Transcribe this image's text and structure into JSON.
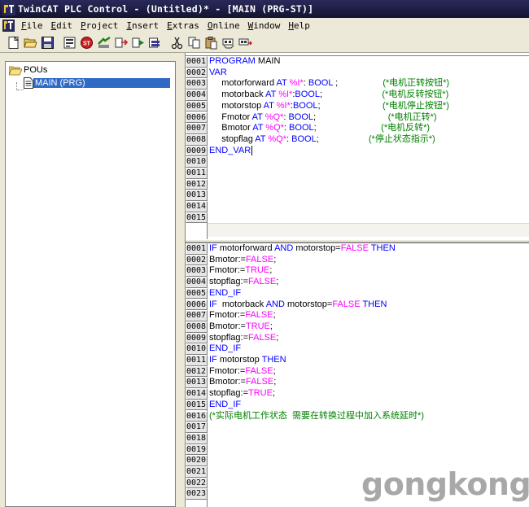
{
  "window": {
    "title": "TwinCAT PLC Control - (Untitled)* - [MAIN (PRG-ST)]"
  },
  "menu": {
    "items": [
      {
        "underline": "F",
        "rest": "ile"
      },
      {
        "underline": "E",
        "rest": "dit"
      },
      {
        "underline": "P",
        "rest": "roject"
      },
      {
        "underline": "I",
        "rest": "nsert"
      },
      {
        "underline": "E",
        "rest": "xtras"
      },
      {
        "underline": "O",
        "rest": "nline"
      },
      {
        "underline": "W",
        "rest": "indow"
      },
      {
        "underline": "H",
        "rest": "elp"
      }
    ]
  },
  "toolbar": {
    "buttons": [
      "new-icon",
      "open-icon",
      "save-icon",
      "sep",
      "build-icon",
      "stop-icon",
      "login-icon",
      "logout-icon",
      "run-icon",
      "step-icon",
      "sep",
      "cut-icon",
      "copy-icon",
      "paste-icon",
      "find-icon",
      "find-next-icon"
    ]
  },
  "tree": {
    "root_label": "POUs",
    "child_label": "MAIN (PRG)"
  },
  "declaration": {
    "lines": [
      {
        "num": "0001",
        "tokens": [
          {
            "t": "kw",
            "v": "PROGRAM"
          },
          {
            "t": "plain",
            "v": " MAIN"
          }
        ]
      },
      {
        "num": "0002",
        "tokens": [
          {
            "t": "kw",
            "v": "VAR"
          }
        ]
      },
      {
        "num": "0003",
        "tokens": [
          {
            "t": "plain",
            "v": "     motorforward "
          },
          {
            "t": "kw",
            "v": "AT"
          },
          {
            "t": "plain",
            "v": " "
          },
          {
            "t": "lit",
            "v": "%I*"
          },
          {
            "t": "plain",
            "v": ": "
          },
          {
            "t": "kw",
            "v": "BOOL"
          },
          {
            "t": "plain",
            "v": " ;                  "
          },
          {
            "t": "cmt",
            "v": "(*电机正转按钮*)"
          }
        ]
      },
      {
        "num": "0004",
        "tokens": [
          {
            "t": "plain",
            "v": "     motorback "
          },
          {
            "t": "kw",
            "v": "AT"
          },
          {
            "t": "plain",
            "v": " "
          },
          {
            "t": "lit",
            "v": "%I*"
          },
          {
            "t": "plain",
            "v": ":"
          },
          {
            "t": "kw",
            "v": "BOOL"
          },
          {
            "t": "plain",
            "v": ";                        "
          },
          {
            "t": "cmt",
            "v": "(*电机反转按钮*)"
          }
        ]
      },
      {
        "num": "0005",
        "tokens": [
          {
            "t": "plain",
            "v": "     motorstop "
          },
          {
            "t": "kw",
            "v": "AT"
          },
          {
            "t": "plain",
            "v": " "
          },
          {
            "t": "lit",
            "v": "%I*"
          },
          {
            "t": "plain",
            "v": ":"
          },
          {
            "t": "kw",
            "v": "BOOL"
          },
          {
            "t": "plain",
            "v": ";                         "
          },
          {
            "t": "cmt",
            "v": "(*电机停止按钮*)"
          }
        ]
      },
      {
        "num": "0006",
        "tokens": [
          {
            "t": "plain",
            "v": "     Fmotor "
          },
          {
            "t": "kw",
            "v": "AT"
          },
          {
            "t": "plain",
            "v": " "
          },
          {
            "t": "lit",
            "v": "%Q*"
          },
          {
            "t": "plain",
            "v": ": "
          },
          {
            "t": "kw",
            "v": "BOOL"
          },
          {
            "t": "plain",
            "v": ";                             "
          },
          {
            "t": "cmt",
            "v": "(*电机正转*)"
          }
        ]
      },
      {
        "num": "0007",
        "tokens": [
          {
            "t": "plain",
            "v": "     Bmotor "
          },
          {
            "t": "kw",
            "v": "AT"
          },
          {
            "t": "plain",
            "v": " "
          },
          {
            "t": "lit",
            "v": "%Q*"
          },
          {
            "t": "plain",
            "v": ": "
          },
          {
            "t": "kw",
            "v": "BOOL"
          },
          {
            "t": "plain",
            "v": ";                          "
          },
          {
            "t": "cmt",
            "v": "(*电机反转*)"
          }
        ]
      },
      {
        "num": "0008",
        "tokens": [
          {
            "t": "plain",
            "v": "     stopflag "
          },
          {
            "t": "kw",
            "v": "AT"
          },
          {
            "t": "plain",
            "v": " "
          },
          {
            "t": "lit",
            "v": "%Q*"
          },
          {
            "t": "plain",
            "v": ": "
          },
          {
            "t": "kw",
            "v": "BOOL"
          },
          {
            "t": "plain",
            "v": ";                    "
          },
          {
            "t": "cmt",
            "v": "(*停止状态指示*)"
          }
        ]
      },
      {
        "num": "0009",
        "tokens": [
          {
            "t": "kw",
            "v": "END_VAR"
          }
        ],
        "caret": true
      },
      {
        "num": "0010",
        "tokens": []
      },
      {
        "num": "0011",
        "tokens": []
      },
      {
        "num": "0012",
        "tokens": []
      },
      {
        "num": "0013",
        "tokens": []
      },
      {
        "num": "0014",
        "tokens": []
      },
      {
        "num": "0015",
        "tokens": []
      }
    ]
  },
  "body": {
    "lines": [
      {
        "num": "0001",
        "tokens": [
          {
            "t": "kw",
            "v": "IF"
          },
          {
            "t": "plain",
            "v": " motorforward "
          },
          {
            "t": "kw",
            "v": "AND"
          },
          {
            "t": "plain",
            "v": " motorstop="
          },
          {
            "t": "lit",
            "v": "FALSE"
          },
          {
            "t": "plain",
            "v": " "
          },
          {
            "t": "kw",
            "v": "THEN"
          }
        ]
      },
      {
        "num": "0002",
        "tokens": [
          {
            "t": "plain",
            "v": "Bmotor:="
          },
          {
            "t": "lit",
            "v": "FALSE"
          },
          {
            "t": "plain",
            "v": ";"
          }
        ]
      },
      {
        "num": "0003",
        "tokens": [
          {
            "t": "plain",
            "v": "Fmotor:="
          },
          {
            "t": "lit",
            "v": "TRUE"
          },
          {
            "t": "plain",
            "v": ";"
          }
        ]
      },
      {
        "num": "0004",
        "tokens": [
          {
            "t": "plain",
            "v": "stopflag:="
          },
          {
            "t": "lit",
            "v": "FALSE"
          },
          {
            "t": "plain",
            "v": ";"
          }
        ]
      },
      {
        "num": "0005",
        "tokens": [
          {
            "t": "kw",
            "v": "END_IF"
          }
        ]
      },
      {
        "num": "0006",
        "tokens": [
          {
            "t": "kw",
            "v": "IF"
          },
          {
            "t": "plain",
            "v": "  motorback "
          },
          {
            "t": "kw",
            "v": "AND"
          },
          {
            "t": "plain",
            "v": " motorstop="
          },
          {
            "t": "lit",
            "v": "FALSE"
          },
          {
            "t": "plain",
            "v": " "
          },
          {
            "t": "kw",
            "v": "THEN"
          }
        ]
      },
      {
        "num": "0007",
        "tokens": [
          {
            "t": "plain",
            "v": "Fmotor:="
          },
          {
            "t": "lit",
            "v": "FALSE"
          },
          {
            "t": "plain",
            "v": ";"
          }
        ]
      },
      {
        "num": "0008",
        "tokens": [
          {
            "t": "plain",
            "v": "Bmotor:="
          },
          {
            "t": "lit",
            "v": "TRUE"
          },
          {
            "t": "plain",
            "v": ";"
          }
        ]
      },
      {
        "num": "0009",
        "tokens": [
          {
            "t": "plain",
            "v": "stopflag:="
          },
          {
            "t": "lit",
            "v": "FALSE"
          },
          {
            "t": "plain",
            "v": ";"
          }
        ]
      },
      {
        "num": "0010",
        "tokens": [
          {
            "t": "kw",
            "v": "END_IF"
          }
        ]
      },
      {
        "num": "0011",
        "tokens": [
          {
            "t": "kw",
            "v": "IF"
          },
          {
            "t": "plain",
            "v": " motorstop "
          },
          {
            "t": "kw",
            "v": "THEN"
          }
        ]
      },
      {
        "num": "0012",
        "tokens": [
          {
            "t": "plain",
            "v": "Fmotor:="
          },
          {
            "t": "lit",
            "v": "FALSE"
          },
          {
            "t": "plain",
            "v": ";"
          }
        ]
      },
      {
        "num": "0013",
        "tokens": [
          {
            "t": "plain",
            "v": "Bmotor:="
          },
          {
            "t": "lit",
            "v": "FALSE"
          },
          {
            "t": "plain",
            "v": ";"
          }
        ]
      },
      {
        "num": "0014",
        "tokens": [
          {
            "t": "plain",
            "v": "stopflag:="
          },
          {
            "t": "lit",
            "v": "TRUE"
          },
          {
            "t": "plain",
            "v": ";"
          }
        ]
      },
      {
        "num": "0015",
        "tokens": [
          {
            "t": "kw",
            "v": "END_IF"
          }
        ]
      },
      {
        "num": "0016",
        "tokens": [
          {
            "t": "cmt",
            "v": "(*实际电机工作状态  需要在转换过程中加入系统延时*)"
          }
        ]
      },
      {
        "num": "0017",
        "tokens": []
      },
      {
        "num": "0018",
        "tokens": []
      },
      {
        "num": "0019",
        "tokens": []
      },
      {
        "num": "0020",
        "tokens": []
      },
      {
        "num": "0021",
        "tokens": []
      },
      {
        "num": "0022",
        "tokens": []
      },
      {
        "num": "0023",
        "tokens": []
      }
    ]
  },
  "watermark": "gongkong",
  "colors": {
    "keyword": "#0000ff",
    "literal": "#ff00ff",
    "comment": "#008000",
    "selection": "#316ac5"
  }
}
